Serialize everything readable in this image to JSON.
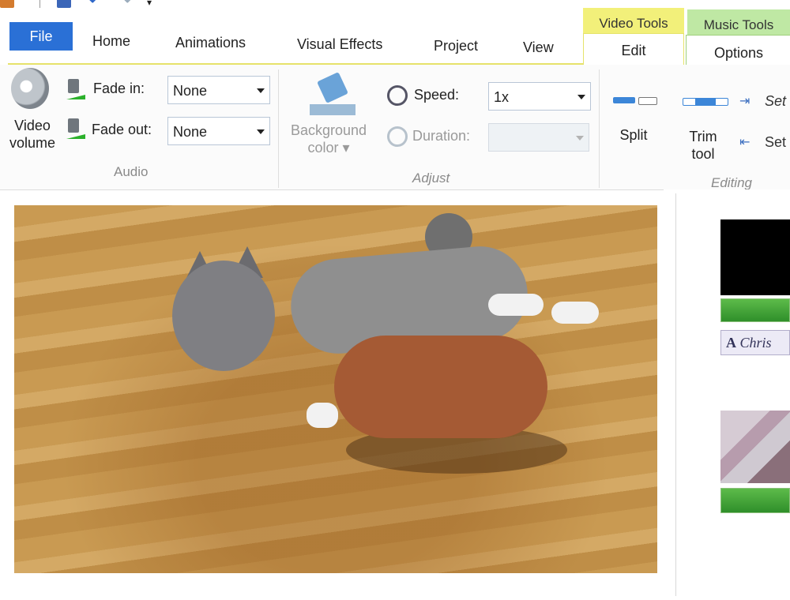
{
  "tabs": {
    "file": "File",
    "home": "Home",
    "animations": "Animations",
    "visual_effects": "Visual Effects",
    "project": "Project",
    "view": "View",
    "edit": "Edit",
    "options": "Options"
  },
  "context_tabs": {
    "video_tools": "Video Tools",
    "music_tools": "Music Tools"
  },
  "audio_group": {
    "video_volume_line1": "Video",
    "video_volume_line2": "volume",
    "fade_in_label": "Fade in:",
    "fade_in_value": "None",
    "fade_out_label": "Fade out:",
    "fade_out_value": "None",
    "group_label": "Audio"
  },
  "adjust_group": {
    "background_color_line1": "Background",
    "background_color_line2": "color",
    "speed_label": "Speed:",
    "speed_value": "1x",
    "duration_label": "Duration:",
    "duration_value": "",
    "group_label": "Adjust"
  },
  "editing_group": {
    "split_label": "Split",
    "trim_line1": "Trim",
    "trim_line2": "tool",
    "set_start_label": "Set",
    "set_end_label": "Set",
    "group_label": "Editing"
  },
  "storyboard": {
    "caption_text": "Chris"
  },
  "colors": {
    "file_tab": "#2a70d6",
    "video_tools": "#f2f07a",
    "music_tools": "#bfe8a4",
    "accent_blue": "#3c86d8"
  }
}
